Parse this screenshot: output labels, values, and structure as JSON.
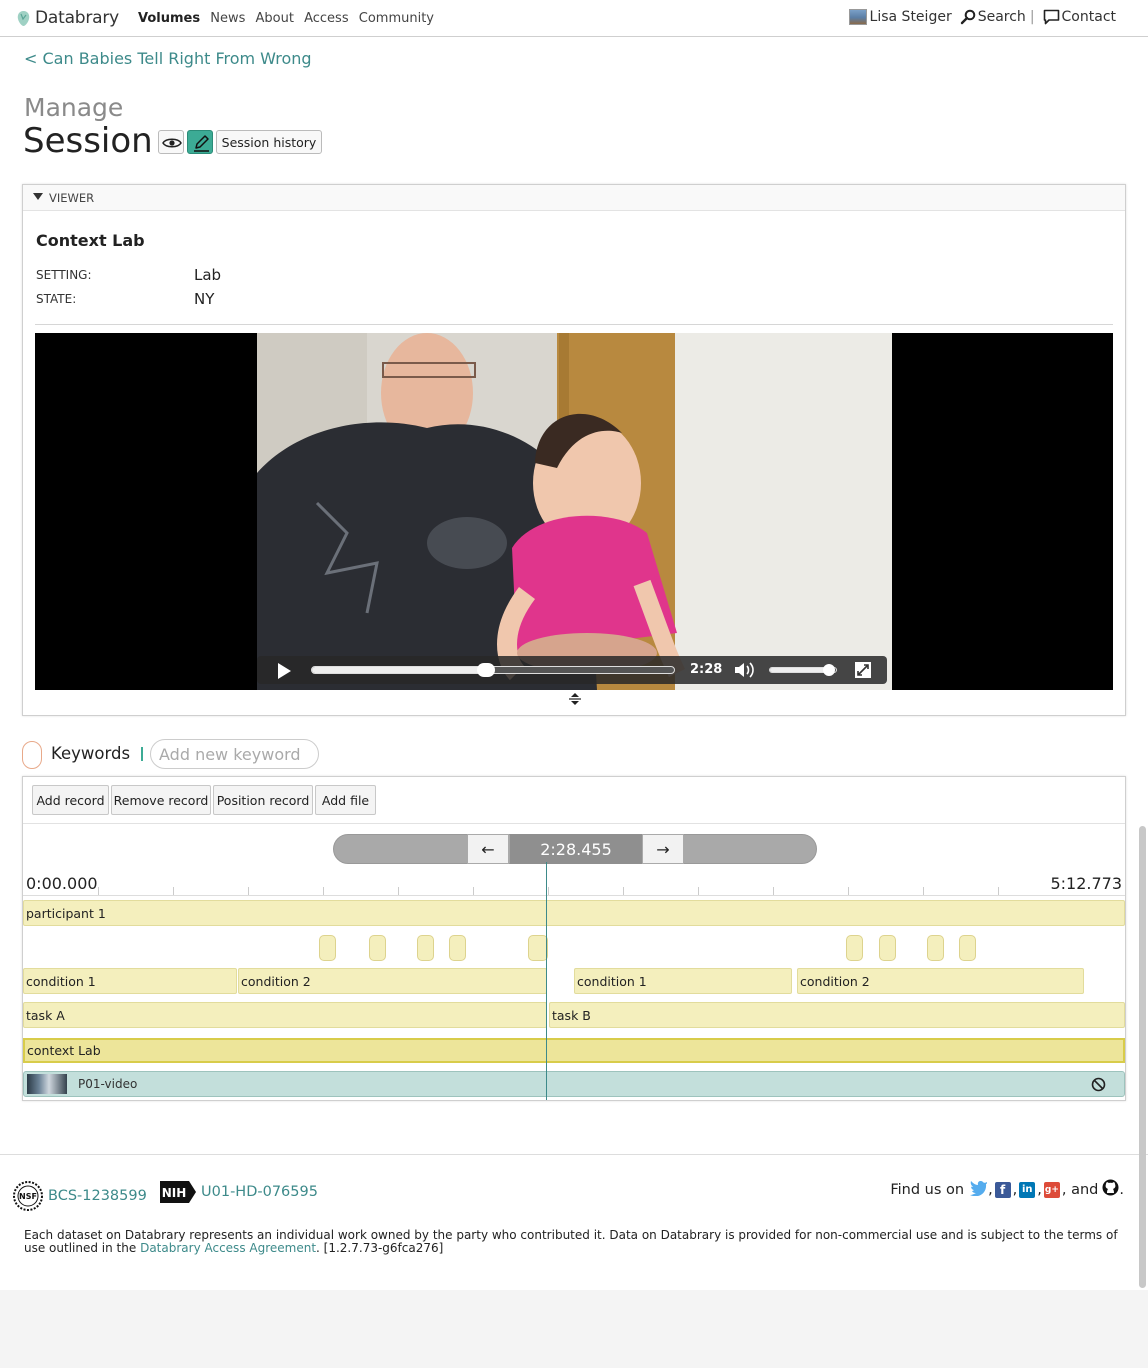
{
  "nav": {
    "brand": "Databrary",
    "links": [
      "Volumes",
      "News",
      "About",
      "Access",
      "Community"
    ],
    "user": "Lisa Steiger",
    "search": "Search",
    "contact": "Contact",
    "separator": "|"
  },
  "header": {
    "back_link": "< Can Babies Tell Right From Wrong",
    "manage": "Manage",
    "title": "Session",
    "history_button": "Session history"
  },
  "viewer": {
    "section_label": "VIEWER",
    "context_title": "Context Lab",
    "fields": [
      {
        "key": "SETTING:",
        "value": "Lab"
      },
      {
        "key": "STATE:",
        "value": "NY"
      }
    ],
    "video": {
      "time": "2:28",
      "progress": 0.48,
      "volume": 0.9
    }
  },
  "keywords": {
    "label": "Keywords",
    "placeholder": "Add new keyword"
  },
  "timeline": {
    "buttons": [
      "Add record",
      "Remove record",
      "Position record",
      "Add file"
    ],
    "current_time": "2:28.455",
    "prev_arrow": "←",
    "next_arrow": "→",
    "start": "0:00.000",
    "end": "5:12.773",
    "tracks": {
      "participant": "participant 1",
      "conditions": [
        "condition 1",
        "condition 2",
        "condition 1",
        "condition 2"
      ],
      "tasks": [
        "task A",
        "task B"
      ],
      "context": "context Lab",
      "file": "P01-video"
    }
  },
  "footer": {
    "grant_nsf_badge": "NSF",
    "grant_nsf": "BCS-1238599",
    "grant_nih_badge": "NIH",
    "grant_nih": "U01-HD-076595",
    "find_us": "Find us on",
    "and": ", and",
    "period": ".",
    "legal_text": "Each dataset on Databrary represents an individual work owned by the party who contributed it. Data on Databrary is provided for non-commercial use and is subject to the terms of use outlined in the",
    "legal_link": "Databrary Access Agreement",
    "version": ". [1.2.7.73-g6fca276]"
  },
  "colors": {
    "accent": "#3d8a8a",
    "edit_button": "#3cab95",
    "record_fill": "#f4efbd",
    "file_fill": "#c3dfdb"
  }
}
